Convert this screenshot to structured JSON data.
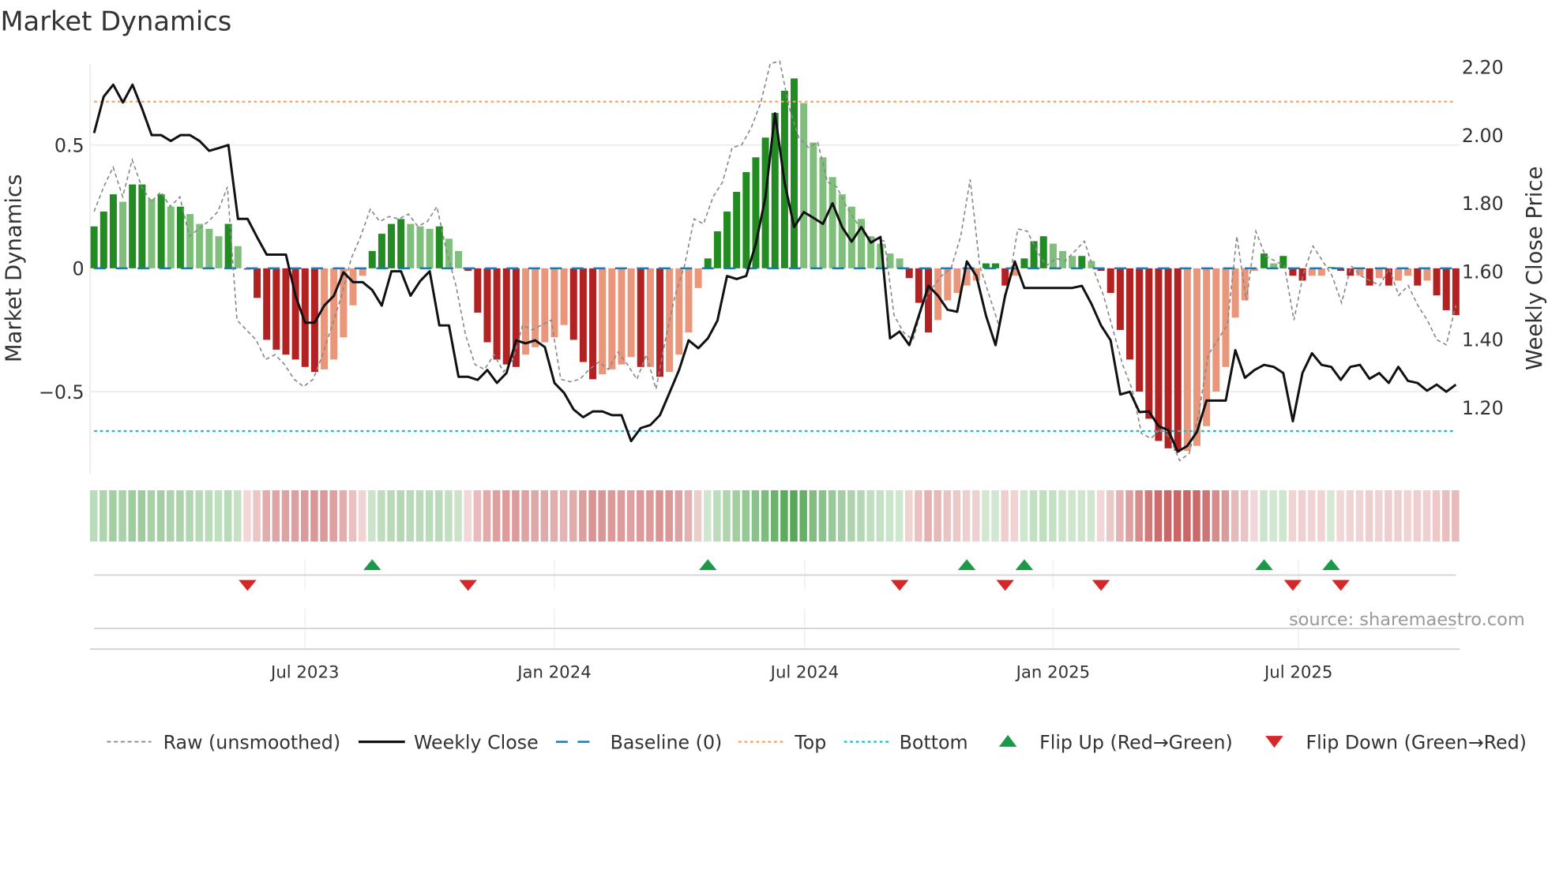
{
  "title": "Market Dynamics",
  "source": "source: sharemaestro.com",
  "colors": {
    "rising_positive": "#228b22",
    "falling_positive": "#7fbf7b",
    "falling_negative": "#b22222",
    "rising_negative": "#e9967a",
    "price": "#111111",
    "raw": "#888888",
    "baseline": "#1f77b4",
    "top": "#f4a460",
    "bottom": "#17becf",
    "flip_up": "#1a9a48",
    "flip_down": "#d62728"
  },
  "chart_data": {
    "type": "bar",
    "title": "Market Dynamics",
    "ylabel": "Market Dynamics",
    "y2label": "Weekly Close Price",
    "ylim": [
      -0.83,
      0.83
    ],
    "y2lim": [
      1.0,
      2.22
    ],
    "yticks": [
      {
        "v": 0.5,
        "label": "0.5"
      },
      {
        "v": 0,
        "label": "0"
      },
      {
        "v": -0.5,
        "label": "−0.5"
      }
    ],
    "y2ticks": [
      {
        "v": 2.2,
        "label": "2.20"
      },
      {
        "v": 2.0,
        "label": "2.00"
      },
      {
        "v": 1.8,
        "label": "1.80"
      },
      {
        "v": 1.6,
        "label": "1.60"
      },
      {
        "v": 1.4,
        "label": "1.40"
      },
      {
        "v": 1.2,
        "label": "1.20"
      }
    ],
    "xticks": [
      {
        "week": 22,
        "label": "Jul 2023"
      },
      {
        "week": 48,
        "label": "Jan 2024"
      },
      {
        "week": 74.1,
        "label": "Jul 2024"
      },
      {
        "week": 100,
        "label": "Jan 2025"
      },
      {
        "week": 125.6,
        "label": "Jul 2025"
      }
    ],
    "top_level": 0.676,
    "bottom_level": -0.66,
    "baseline": 0,
    "dynamics": [
      0.17,
      0.23,
      0.3,
      0.27,
      0.34,
      0.34,
      0.28,
      0.3,
      0.25,
      0.25,
      0.22,
      0.18,
      0.16,
      0.13,
      0.18,
      0.09,
      -0.005,
      -0.12,
      -0.29,
      -0.33,
      -0.35,
      -0.37,
      -0.4,
      -0.42,
      -0.41,
      -0.37,
      -0.28,
      -0.15,
      -0.03,
      0.07,
      0.14,
      0.18,
      0.2,
      0.18,
      0.17,
      0.16,
      0.17,
      0.12,
      0.07,
      -0.01,
      -0.18,
      -0.3,
      -0.37,
      -0.39,
      -0.4,
      -0.35,
      -0.32,
      -0.3,
      -0.28,
      -0.23,
      -0.29,
      -0.38,
      -0.45,
      -0.43,
      -0.41,
      -0.39,
      -0.36,
      -0.4,
      -0.4,
      -0.44,
      -0.42,
      -0.35,
      -0.26,
      -0.08,
      0.04,
      0.15,
      0.23,
      0.31,
      0.39,
      0.45,
      0.53,
      0.63,
      0.72,
      0.77,
      0.67,
      0.51,
      0.45,
      0.37,
      0.3,
      0.25,
      0.2,
      0.13,
      0.1,
      0.06,
      0.04,
      -0.04,
      -0.14,
      -0.26,
      -0.21,
      -0.13,
      -0.1,
      -0.07,
      -0.05,
      0.02,
      0.02,
      -0.07,
      -0.03,
      0.04,
      0.11,
      0.13,
      0.1,
      0.07,
      0.05,
      0.05,
      0.03,
      -0.01,
      -0.1,
      -0.25,
      -0.37,
      -0.5,
      -0.61,
      -0.7,
      -0.73,
      -0.74,
      -0.74,
      -0.72,
      -0.64,
      -0.5,
      -0.4,
      -0.2,
      -0.13,
      -0.01,
      0.06,
      0.02,
      0.05,
      -0.03,
      -0.05,
      -0.03,
      -0.03,
      0.005,
      -0.01,
      -0.03,
      -0.03,
      -0.07,
      -0.04,
      -0.07,
      -0.05,
      -0.03,
      -0.07,
      -0.05,
      -0.11,
      -0.17,
      -0.19
    ],
    "raw": [
      0.23,
      0.33,
      0.41,
      0.29,
      0.44,
      0.33,
      0.27,
      0.31,
      0.25,
      0.29,
      0.13,
      0.16,
      0.19,
      0.23,
      0.33,
      -0.21,
      -0.25,
      -0.29,
      -0.37,
      -0.35,
      -0.39,
      -0.45,
      -0.48,
      -0.45,
      -0.35,
      -0.23,
      -0.11,
      0.04,
      0.13,
      0.24,
      0.19,
      0.21,
      0.2,
      0.22,
      0.17,
      0.19,
      0.25,
      0.07,
      -0.07,
      -0.27,
      -0.39,
      -0.41,
      -0.35,
      -0.42,
      -0.37,
      -0.23,
      -0.25,
      -0.23,
      -0.21,
      -0.45,
      -0.46,
      -0.45,
      -0.41,
      -0.38,
      -0.41,
      -0.34,
      -0.39,
      -0.45,
      -0.35,
      -0.49,
      -0.29,
      -0.11,
      0.01,
      0.2,
      0.18,
      0.29,
      0.35,
      0.49,
      0.5,
      0.57,
      0.67,
      0.83,
      0.84,
      0.65,
      0.53,
      0.49,
      0.51,
      0.35,
      0.33,
      0.25,
      0.19,
      0.13,
      0.12,
      0.11,
      -0.19,
      -0.26,
      -0.29,
      -0.15,
      -0.08,
      -0.03,
      0,
      0.13,
      0.36,
      0.01,
      -0.11,
      -0.23,
      -0.07,
      0.16,
      0.15,
      0.07,
      0.01,
      0.04,
      0.03,
      0.07,
      0.11,
      -0.01,
      -0.11,
      -0.25,
      -0.39,
      -0.49,
      -0.67,
      -0.69,
      -0.65,
      -0.69,
      -0.78,
      -0.75,
      -0.59,
      -0.35,
      -0.29,
      -0.23,
      0.13,
      -0.13,
      0.15,
      0.05,
      0.03,
      0.01,
      -0.21,
      -0.02,
      0.09,
      0.03,
      -0.03,
      -0.14,
      0.01,
      -0.03,
      -0.05,
      -0.07,
      0,
      -0.11,
      -0.07,
      -0.15,
      -0.21,
      -0.29,
      -0.31,
      -0.15
    ],
    "weekly_close": [
      2.006,
      2.113,
      2.148,
      2.096,
      2.148,
      2.078,
      2.0,
      2.0,
      1.983,
      2.0,
      2.0,
      1.983,
      1.954,
      1.962,
      1.971,
      1.754,
      1.754,
      1.7,
      1.649,
      1.649,
      1.649,
      1.528,
      1.449,
      1.449,
      1.499,
      1.528,
      1.597,
      1.568,
      1.568,
      1.545,
      1.499,
      1.6,
      1.6,
      1.528,
      1.571,
      1.6,
      1.441,
      1.441,
      1.29,
      1.29,
      1.281,
      1.31,
      1.272,
      1.301,
      1.397,
      1.388,
      1.397,
      1.377,
      1.272,
      1.243,
      1.194,
      1.171,
      1.188,
      1.188,
      1.177,
      1.177,
      1.101,
      1.139,
      1.148,
      1.177,
      1.243,
      1.31,
      1.397,
      1.374,
      1.403,
      1.455,
      1.586,
      1.577,
      1.586,
      1.681,
      1.817,
      2.064,
      1.861,
      1.73,
      1.774,
      1.757,
      1.739,
      1.8,
      1.73,
      1.687,
      1.73,
      1.684,
      1.701,
      1.403,
      1.423,
      1.383,
      1.47,
      1.557,
      1.528,
      1.487,
      1.481,
      1.629,
      1.586,
      1.47,
      1.383,
      1.528,
      1.629,
      1.551,
      1.551,
      1.551,
      1.551,
      1.551,
      1.551,
      1.557,
      1.504,
      1.441,
      1.397,
      1.238,
      1.246,
      1.186,
      1.188,
      1.145,
      1.133,
      1.07,
      1.087,
      1.128,
      1.22,
      1.22,
      1.22,
      1.368,
      1.287,
      1.31,
      1.325,
      1.319,
      1.301,
      1.159,
      1.301,
      1.359,
      1.325,
      1.319,
      1.281,
      1.319,
      1.325,
      1.284,
      1.301,
      1.272,
      1.319,
      1.278,
      1.272,
      1.249,
      1.267,
      1.246,
      1.267
    ],
    "flip_up_weeks": [
      29,
      64,
      91,
      97,
      122,
      129
    ],
    "flip_down_weeks": [
      16,
      39,
      84,
      95,
      105,
      125,
      130
    ],
    "legend": {
      "placement": "bottom",
      "items": [
        {
          "key": "raw",
          "label": "Raw (unsmoothed)"
        },
        {
          "key": "price",
          "label": "Weekly Close"
        },
        {
          "key": "baseline",
          "label": "Baseline (0)"
        },
        {
          "key": "top",
          "label": "Top"
        },
        {
          "key": "bottom",
          "label": "Bottom"
        },
        {
          "key": "flip_up",
          "label": "Flip Up (Red→Green)"
        },
        {
          "key": "flip_down",
          "label": "Flip Down (Green→Red)"
        }
      ]
    }
  }
}
